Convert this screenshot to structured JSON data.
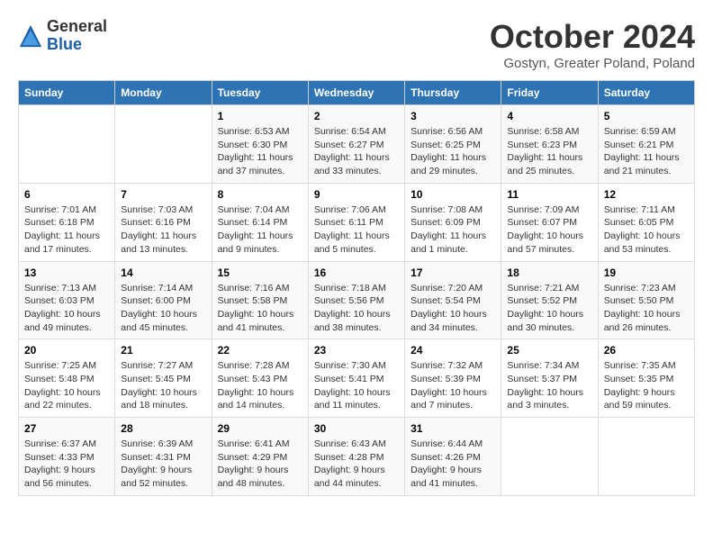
{
  "header": {
    "logo_general": "General",
    "logo_blue": "Blue",
    "month_title": "October 2024",
    "location": "Gostyn, Greater Poland, Poland"
  },
  "weekdays": [
    "Sunday",
    "Monday",
    "Tuesday",
    "Wednesday",
    "Thursday",
    "Friday",
    "Saturday"
  ],
  "weeks": [
    [
      {
        "day": "",
        "info": ""
      },
      {
        "day": "",
        "info": ""
      },
      {
        "day": "1",
        "info": "Sunrise: 6:53 AM\nSunset: 6:30 PM\nDaylight: 11 hours and 37 minutes."
      },
      {
        "day": "2",
        "info": "Sunrise: 6:54 AM\nSunset: 6:27 PM\nDaylight: 11 hours and 33 minutes."
      },
      {
        "day": "3",
        "info": "Sunrise: 6:56 AM\nSunset: 6:25 PM\nDaylight: 11 hours and 29 minutes."
      },
      {
        "day": "4",
        "info": "Sunrise: 6:58 AM\nSunset: 6:23 PM\nDaylight: 11 hours and 25 minutes."
      },
      {
        "day": "5",
        "info": "Sunrise: 6:59 AM\nSunset: 6:21 PM\nDaylight: 11 hours and 21 minutes."
      }
    ],
    [
      {
        "day": "6",
        "info": "Sunrise: 7:01 AM\nSunset: 6:18 PM\nDaylight: 11 hours and 17 minutes."
      },
      {
        "day": "7",
        "info": "Sunrise: 7:03 AM\nSunset: 6:16 PM\nDaylight: 11 hours and 13 minutes."
      },
      {
        "day": "8",
        "info": "Sunrise: 7:04 AM\nSunset: 6:14 PM\nDaylight: 11 hours and 9 minutes."
      },
      {
        "day": "9",
        "info": "Sunrise: 7:06 AM\nSunset: 6:11 PM\nDaylight: 11 hours and 5 minutes."
      },
      {
        "day": "10",
        "info": "Sunrise: 7:08 AM\nSunset: 6:09 PM\nDaylight: 11 hours and 1 minute."
      },
      {
        "day": "11",
        "info": "Sunrise: 7:09 AM\nSunset: 6:07 PM\nDaylight: 10 hours and 57 minutes."
      },
      {
        "day": "12",
        "info": "Sunrise: 7:11 AM\nSunset: 6:05 PM\nDaylight: 10 hours and 53 minutes."
      }
    ],
    [
      {
        "day": "13",
        "info": "Sunrise: 7:13 AM\nSunset: 6:03 PM\nDaylight: 10 hours and 49 minutes."
      },
      {
        "day": "14",
        "info": "Sunrise: 7:14 AM\nSunset: 6:00 PM\nDaylight: 10 hours and 45 minutes."
      },
      {
        "day": "15",
        "info": "Sunrise: 7:16 AM\nSunset: 5:58 PM\nDaylight: 10 hours and 41 minutes."
      },
      {
        "day": "16",
        "info": "Sunrise: 7:18 AM\nSunset: 5:56 PM\nDaylight: 10 hours and 38 minutes."
      },
      {
        "day": "17",
        "info": "Sunrise: 7:20 AM\nSunset: 5:54 PM\nDaylight: 10 hours and 34 minutes."
      },
      {
        "day": "18",
        "info": "Sunrise: 7:21 AM\nSunset: 5:52 PM\nDaylight: 10 hours and 30 minutes."
      },
      {
        "day": "19",
        "info": "Sunrise: 7:23 AM\nSunset: 5:50 PM\nDaylight: 10 hours and 26 minutes."
      }
    ],
    [
      {
        "day": "20",
        "info": "Sunrise: 7:25 AM\nSunset: 5:48 PM\nDaylight: 10 hours and 22 minutes."
      },
      {
        "day": "21",
        "info": "Sunrise: 7:27 AM\nSunset: 5:45 PM\nDaylight: 10 hours and 18 minutes."
      },
      {
        "day": "22",
        "info": "Sunrise: 7:28 AM\nSunset: 5:43 PM\nDaylight: 10 hours and 14 minutes."
      },
      {
        "day": "23",
        "info": "Sunrise: 7:30 AM\nSunset: 5:41 PM\nDaylight: 10 hours and 11 minutes."
      },
      {
        "day": "24",
        "info": "Sunrise: 7:32 AM\nSunset: 5:39 PM\nDaylight: 10 hours and 7 minutes."
      },
      {
        "day": "25",
        "info": "Sunrise: 7:34 AM\nSunset: 5:37 PM\nDaylight: 10 hours and 3 minutes."
      },
      {
        "day": "26",
        "info": "Sunrise: 7:35 AM\nSunset: 5:35 PM\nDaylight: 9 hours and 59 minutes."
      }
    ],
    [
      {
        "day": "27",
        "info": "Sunrise: 6:37 AM\nSunset: 4:33 PM\nDaylight: 9 hours and 56 minutes."
      },
      {
        "day": "28",
        "info": "Sunrise: 6:39 AM\nSunset: 4:31 PM\nDaylight: 9 hours and 52 minutes."
      },
      {
        "day": "29",
        "info": "Sunrise: 6:41 AM\nSunset: 4:29 PM\nDaylight: 9 hours and 48 minutes."
      },
      {
        "day": "30",
        "info": "Sunrise: 6:43 AM\nSunset: 4:28 PM\nDaylight: 9 hours and 44 minutes."
      },
      {
        "day": "31",
        "info": "Sunrise: 6:44 AM\nSunset: 4:26 PM\nDaylight: 9 hours and 41 minutes."
      },
      {
        "day": "",
        "info": ""
      },
      {
        "day": "",
        "info": ""
      }
    ]
  ]
}
